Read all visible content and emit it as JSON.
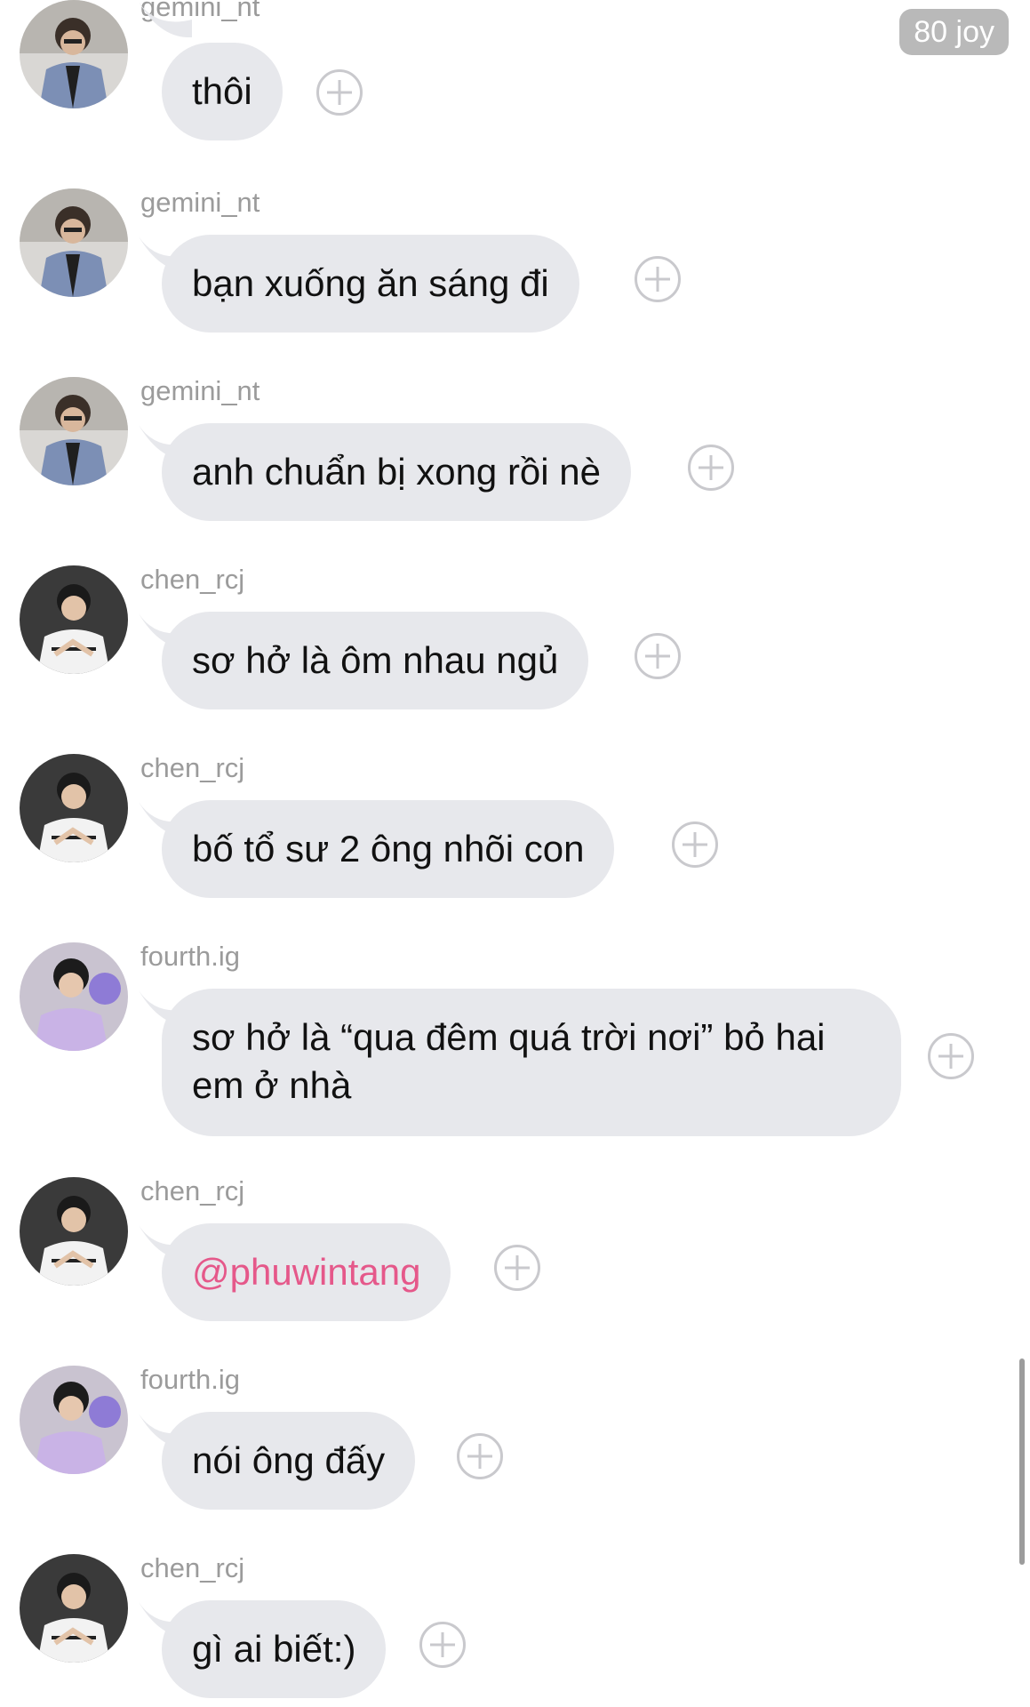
{
  "badge": {
    "label": "80 joy"
  },
  "messages": [
    {
      "user": "gemini_nt",
      "text": "thôi",
      "avatar": "gemini"
    },
    {
      "user": "gemini_nt",
      "text": "bạn xuống ăn sáng đi",
      "avatar": "gemini"
    },
    {
      "user": "gemini_nt",
      "text": "anh chuẩn bị xong rồi nè",
      "avatar": "gemini"
    },
    {
      "user": "chen_rcj",
      "text": "sơ hở là ôm nhau ngủ",
      "avatar": "chen"
    },
    {
      "user": "chen_rcj",
      "text": "bố tổ sư 2 ông nhõi con",
      "avatar": "chen"
    },
    {
      "user": "fourth.ig",
      "text": "sơ hở là “qua đêm quá trời nơi” bỏ hai em ở nhà",
      "avatar": "fourth"
    },
    {
      "user": "chen_rcj",
      "text": "@phuwintang",
      "avatar": "chen",
      "mention": true
    },
    {
      "user": "fourth.ig",
      "text": "nói ông đấy",
      "avatar": "fourth"
    },
    {
      "user": "chen_rcj",
      "text": "gì ai biết:)",
      "avatar": "chen"
    }
  ],
  "colors": {
    "bubble": "#e7e8ec",
    "mention": "#e5588a",
    "username": "#9b9b9b",
    "badge": "#b9b9b9"
  },
  "icons": {
    "add_reaction": "plus-circle-icon"
  }
}
